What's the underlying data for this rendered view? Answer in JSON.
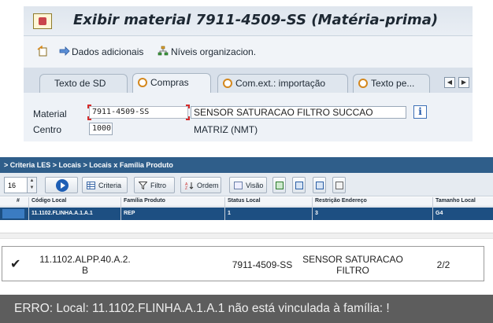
{
  "sap": {
    "title": "Exibir material 7911-4509-SS (Matéria-prima)",
    "toolbar": {
      "additional_data": "Dados adicionais",
      "org_levels": "Níveis organizacion."
    },
    "tabs": [
      {
        "label": "Texto de SD"
      },
      {
        "label": "Compras"
      },
      {
        "label": "Com.ext.: importação"
      },
      {
        "label": "Texto pe..."
      }
    ],
    "material_label": "Material",
    "material_value": "7911-4509-SS",
    "material_description": "SENSOR SATURACAO FILTRO SUCCAO",
    "plant_label": "Centro",
    "plant_value": "1000",
    "plant_description": "MATRIZ (NMT)",
    "info_icon": "i"
  },
  "les": {
    "breadcrumb": "> Criteria LES > Locais > Locais x Família Produto",
    "page_size": "16",
    "buttons": {
      "criteria": "Criteria",
      "filter": "Filtro",
      "order": "Ordem",
      "view": "Visão"
    },
    "columns": [
      "#",
      "Código Local",
      "Família Produto",
      "Status Local",
      "Restrição Endereço",
      "Tamanho Local"
    ],
    "rows": [
      {
        "code": "11.1102.FLINHA.A.1.A.1",
        "family": "REP",
        "status": "1",
        "restriction": "3",
        "size": "G4"
      }
    ]
  },
  "list": {
    "check_icon": "double-check-icon",
    "location_line1": "11.1102.ALPP.40.A.2.",
    "location_line2": "B",
    "material": "7911-4509-SS",
    "desc_line1": "SENSOR SATURACAO",
    "desc_line2": "FILTRO",
    "ratio": "2/2"
  },
  "error": {
    "message": "ERRO: Local: 11.1102.FLINHA.A.1.A.1 não está vinculada à família: !"
  },
  "colors": {
    "les_header": "#2f5e8a",
    "selected_row": "#1d4f82",
    "error_bg": "#5d5d5d",
    "sap_bg": "#eef2f7"
  }
}
